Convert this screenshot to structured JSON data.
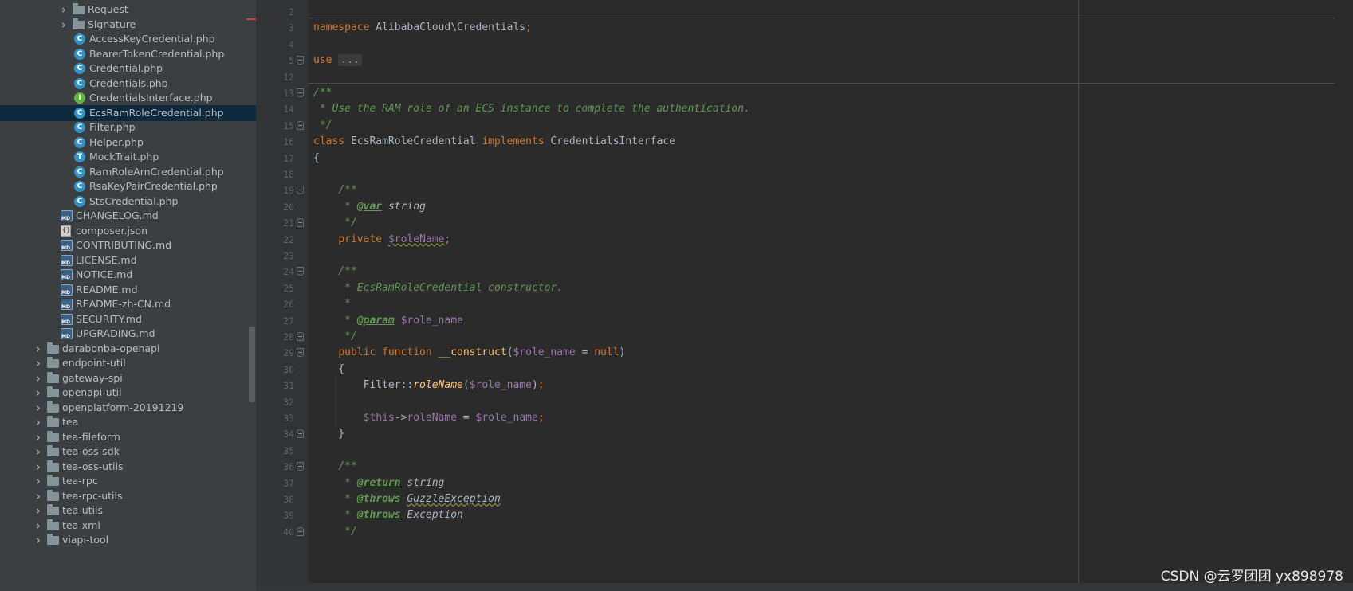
{
  "project_tree": {
    "items": [
      {
        "label": "Request",
        "kind": "folder",
        "icon": "folder-icon",
        "indent": 2,
        "expandable": true
      },
      {
        "label": "Signature",
        "kind": "folder",
        "icon": "folder-icon",
        "indent": 2,
        "expandable": true
      },
      {
        "label": "AccessKeyCredential.php",
        "kind": "class",
        "icon": "php-class-icon",
        "indent": 3
      },
      {
        "label": "BearerTokenCredential.php",
        "kind": "class",
        "icon": "php-class-icon",
        "indent": 3
      },
      {
        "label": "Credential.php",
        "kind": "class",
        "icon": "php-class-icon",
        "indent": 3
      },
      {
        "label": "Credentials.php",
        "kind": "class",
        "icon": "php-class-icon",
        "indent": 3
      },
      {
        "label": "CredentialsInterface.php",
        "kind": "interface",
        "icon": "php-interface-icon",
        "indent": 3
      },
      {
        "label": "EcsRamRoleCredential.php",
        "kind": "class",
        "icon": "php-class-icon",
        "indent": 3,
        "selected": true
      },
      {
        "label": "Filter.php",
        "kind": "class",
        "icon": "php-class-icon",
        "indent": 3
      },
      {
        "label": "Helper.php",
        "kind": "class",
        "icon": "php-class-icon",
        "indent": 3
      },
      {
        "label": "MockTrait.php",
        "kind": "trait",
        "icon": "php-trait-icon",
        "indent": 3
      },
      {
        "label": "RamRoleArnCredential.php",
        "kind": "class",
        "icon": "php-class-icon",
        "indent": 3
      },
      {
        "label": "RsaKeyPairCredential.php",
        "kind": "class",
        "icon": "php-class-icon",
        "indent": 3
      },
      {
        "label": "StsCredential.php",
        "kind": "class",
        "icon": "php-class-icon",
        "indent": 3
      },
      {
        "label": "CHANGELOG.md",
        "kind": "md",
        "icon": "markdown-file-icon",
        "indent": 2
      },
      {
        "label": "composer.json",
        "kind": "json",
        "icon": "json-file-icon",
        "indent": 2
      },
      {
        "label": "CONTRIBUTING.md",
        "kind": "md",
        "icon": "markdown-file-icon",
        "indent": 2
      },
      {
        "label": "LICENSE.md",
        "kind": "md",
        "icon": "markdown-file-icon",
        "indent": 2
      },
      {
        "label": "NOTICE.md",
        "kind": "md",
        "icon": "markdown-file-icon",
        "indent": 2
      },
      {
        "label": "README.md",
        "kind": "md",
        "icon": "markdown-file-icon",
        "indent": 2
      },
      {
        "label": "README-zh-CN.md",
        "kind": "md",
        "icon": "markdown-file-icon",
        "indent": 2
      },
      {
        "label": "SECURITY.md",
        "kind": "md",
        "icon": "markdown-file-icon",
        "indent": 2
      },
      {
        "label": "UPGRADING.md",
        "kind": "md",
        "icon": "markdown-file-icon",
        "indent": 2
      },
      {
        "label": "darabonba-openapi",
        "kind": "folder",
        "icon": "folder-icon",
        "indent": 1,
        "expandable": true
      },
      {
        "label": "endpoint-util",
        "kind": "folder",
        "icon": "folder-icon",
        "indent": 1,
        "expandable": true
      },
      {
        "label": "gateway-spi",
        "kind": "folder",
        "icon": "folder-icon",
        "indent": 1,
        "expandable": true
      },
      {
        "label": "openapi-util",
        "kind": "folder",
        "icon": "folder-icon",
        "indent": 1,
        "expandable": true
      },
      {
        "label": "openplatform-20191219",
        "kind": "folder",
        "icon": "folder-icon",
        "indent": 1,
        "expandable": true
      },
      {
        "label": "tea",
        "kind": "folder",
        "icon": "folder-icon",
        "indent": 1,
        "expandable": true
      },
      {
        "label": "tea-fileform",
        "kind": "folder",
        "icon": "folder-icon",
        "indent": 1,
        "expandable": true
      },
      {
        "label": "tea-oss-sdk",
        "kind": "folder",
        "icon": "folder-icon",
        "indent": 1,
        "expandable": true
      },
      {
        "label": "tea-oss-utils",
        "kind": "folder",
        "icon": "folder-icon",
        "indent": 1,
        "expandable": true
      },
      {
        "label": "tea-rpc",
        "kind": "folder",
        "icon": "folder-icon",
        "indent": 1,
        "expandable": true
      },
      {
        "label": "tea-rpc-utils",
        "kind": "folder",
        "icon": "folder-icon",
        "indent": 1,
        "expandable": true
      },
      {
        "label": "tea-utils",
        "kind": "folder",
        "icon": "folder-icon",
        "indent": 1,
        "expandable": true
      },
      {
        "label": "tea-xml",
        "kind": "folder",
        "icon": "folder-icon",
        "indent": 1,
        "expandable": true
      },
      {
        "label": "viapi-tool",
        "kind": "folder",
        "icon": "folder-icon",
        "indent": 1,
        "expandable": true
      }
    ]
  },
  "editor": {
    "lines": [
      {
        "no": "2",
        "tokens": []
      },
      {
        "no": "3",
        "tokens": [
          [
            "kw",
            "namespace"
          ],
          [
            "pl",
            " AlibabaCloud\\Credentials"
          ],
          [
            "kw",
            ";"
          ]
        ]
      },
      {
        "no": "4",
        "tokens": []
      },
      {
        "no": "5",
        "tokens": [
          [
            "kw",
            "use"
          ],
          [
            "pl",
            " "
          ],
          [
            "folded",
            "..."
          ]
        ]
      },
      {
        "no": "12",
        "tokens": []
      },
      {
        "no": "13",
        "tokens": [
          [
            "cm",
            "/**"
          ]
        ]
      },
      {
        "no": "14",
        "tokens": [
          [
            "cm",
            " * Use the RAM role of an ECS instance to complete the authentication."
          ]
        ]
      },
      {
        "no": "15",
        "tokens": [
          [
            "cm",
            " */"
          ]
        ]
      },
      {
        "no": "16",
        "tokens": [
          [
            "kw",
            "class"
          ],
          [
            "pl",
            " EcsRamRoleCredential "
          ],
          [
            "kw",
            "implements"
          ],
          [
            "pl",
            " CredentialsInterface"
          ]
        ]
      },
      {
        "no": "17",
        "tokens": [
          [
            "pl",
            "{"
          ]
        ]
      },
      {
        "no": "18",
        "tokens": []
      },
      {
        "no": "19",
        "tokens": [
          [
            "pl",
            "    "
          ],
          [
            "cm",
            "/**"
          ]
        ]
      },
      {
        "no": "20",
        "tokens": [
          [
            "pl",
            "    "
          ],
          [
            "cm",
            " * "
          ],
          [
            "tag",
            "@var"
          ],
          [
            "pl",
            " "
          ],
          [
            "ty",
            "string"
          ]
        ]
      },
      {
        "no": "21",
        "tokens": [
          [
            "pl",
            "    "
          ],
          [
            "cm",
            " */"
          ]
        ]
      },
      {
        "no": "22",
        "tokens": [
          [
            "pl",
            "    "
          ],
          [
            "kw",
            "private"
          ],
          [
            "pl",
            " "
          ],
          [
            "varu",
            "$roleName"
          ],
          [
            "kw",
            ";"
          ]
        ]
      },
      {
        "no": "23",
        "tokens": []
      },
      {
        "no": "24",
        "tokens": [
          [
            "pl",
            "    "
          ],
          [
            "cm",
            "/**"
          ]
        ]
      },
      {
        "no": "25",
        "tokens": [
          [
            "pl",
            "    "
          ],
          [
            "cm",
            " * EcsRamRoleCredential constructor."
          ]
        ]
      },
      {
        "no": "26",
        "tokens": [
          [
            "pl",
            "    "
          ],
          [
            "cm",
            " *"
          ]
        ]
      },
      {
        "no": "27",
        "tokens": [
          [
            "pl",
            "    "
          ],
          [
            "cm",
            " * "
          ],
          [
            "tag",
            "@param"
          ],
          [
            "pl",
            " "
          ],
          [
            "var",
            "$role_name"
          ]
        ]
      },
      {
        "no": "28",
        "tokens": [
          [
            "pl",
            "    "
          ],
          [
            "cm",
            " */"
          ]
        ]
      },
      {
        "no": "29",
        "tokens": [
          [
            "pl",
            "    "
          ],
          [
            "kw",
            "public function"
          ],
          [
            "pl",
            " "
          ],
          [
            "fn",
            "__construct"
          ],
          [
            "pl",
            "("
          ],
          [
            "var",
            "$role_name"
          ],
          [
            "pl",
            " = "
          ],
          [
            "kw",
            "null"
          ],
          [
            "pl",
            ")"
          ]
        ]
      },
      {
        "no": "30",
        "tokens": [
          [
            "pl",
            "    {"
          ]
        ]
      },
      {
        "no": "31",
        "tokens": [
          [
            "pl",
            "        Filter::"
          ],
          [
            "sfn",
            "roleName"
          ],
          [
            "pl",
            "("
          ],
          [
            "var",
            "$role_name"
          ],
          [
            "pl",
            ")"
          ],
          [
            "kw",
            ";"
          ]
        ]
      },
      {
        "no": "32",
        "tokens": []
      },
      {
        "no": "33",
        "tokens": [
          [
            "pl",
            "        "
          ],
          [
            "var",
            "$this"
          ],
          [
            "pl",
            "->"
          ],
          [
            "var",
            "roleName"
          ],
          [
            "pl",
            " = "
          ],
          [
            "var",
            "$role_name"
          ],
          [
            "kw",
            ";"
          ]
        ]
      },
      {
        "no": "34",
        "tokens": [
          [
            "pl",
            "    }"
          ]
        ]
      },
      {
        "no": "35",
        "tokens": []
      },
      {
        "no": "36",
        "tokens": [
          [
            "pl",
            "    "
          ],
          [
            "cm",
            "/**"
          ]
        ]
      },
      {
        "no": "37",
        "tokens": [
          [
            "pl",
            "    "
          ],
          [
            "cm",
            " * "
          ],
          [
            "tag",
            "@return"
          ],
          [
            "pl",
            " "
          ],
          [
            "ty",
            "string"
          ]
        ]
      },
      {
        "no": "38",
        "tokens": [
          [
            "pl",
            "    "
          ],
          [
            "cm",
            " * "
          ],
          [
            "tag",
            "@throws"
          ],
          [
            "pl",
            " "
          ],
          [
            "tyu",
            "GuzzleException"
          ]
        ]
      },
      {
        "no": "39",
        "tokens": [
          [
            "pl",
            "    "
          ],
          [
            "cm",
            " * "
          ],
          [
            "tag",
            "@throws"
          ],
          [
            "pl",
            " "
          ],
          [
            "ty",
            "Exception"
          ]
        ]
      },
      {
        "no": "40",
        "tokens": [
          [
            "pl",
            "    "
          ],
          [
            "cm",
            " */"
          ]
        ]
      }
    ]
  },
  "watermark": "CSDN @云罗团团 yx898978",
  "colors": {
    "tree_bg": "#3c3f41",
    "editor_bg": "#2b2b2b",
    "gutter_bg": "#313335",
    "selection": "#0d293e",
    "keyword": "#cc7832",
    "comment": "#629755",
    "variable": "#9876aa",
    "function": "#ffc66d",
    "text": "#a9b7c6"
  }
}
